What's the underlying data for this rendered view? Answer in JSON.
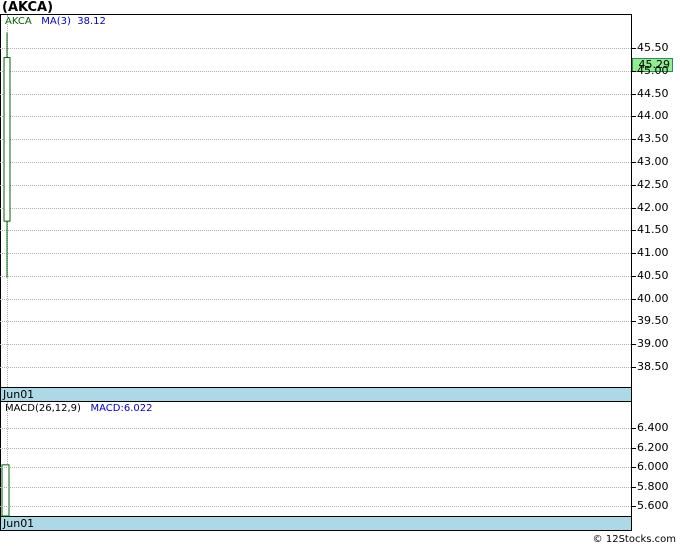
{
  "title": "(AKCA)",
  "price_legend": {
    "symbol": "AKCA",
    "ma_label": "MA(3)",
    "ma_value": "38.12"
  },
  "last_price": "45.29",
  "macd_legend": {
    "label": "MACD(26,12,9)",
    "value": "MACD:6.022"
  },
  "date_label": "Jun01",
  "footer": "© 12Stocks.com",
  "colors": {
    "candle": "#006400",
    "ma": "#0000cd",
    "date_bar": "#add8e6",
    "last_price_bg": "#90ee90"
  },
  "chart_data": [
    {
      "type": "candlestick",
      "title": "(AKCA)",
      "ylim": [
        38.0,
        45.9
      ],
      "yticks": [
        38.5,
        39.0,
        39.5,
        40.0,
        40.5,
        41.0,
        41.5,
        42.0,
        42.5,
        43.0,
        43.5,
        44.0,
        44.5,
        45.0,
        45.5
      ],
      "ytick_labels": [
        "38.50",
        "39.00",
        "39.50",
        "40.00",
        "40.50",
        "41.00",
        "41.50",
        "42.00",
        "42.50",
        "43.00",
        "43.50",
        "44.00",
        "44.50",
        "45.00",
        "45.50"
      ],
      "x": [
        "Jun01"
      ],
      "open": [
        41.7
      ],
      "close": [
        45.29
      ],
      "high": [
        45.75
      ],
      "low": [
        40.55
      ],
      "grid": true
    },
    {
      "type": "bar",
      "title": "MACD(26,12,9)",
      "ylim": [
        5.5,
        6.6
      ],
      "yticks": [
        5.6,
        5.8,
        6.0,
        6.2,
        6.4
      ],
      "ytick_labels": [
        "5.600",
        "5.800",
        "6.000",
        "6.200",
        "6.400"
      ],
      "x": [
        "Jun01"
      ],
      "values": [
        6.022
      ],
      "grid": true
    }
  ]
}
